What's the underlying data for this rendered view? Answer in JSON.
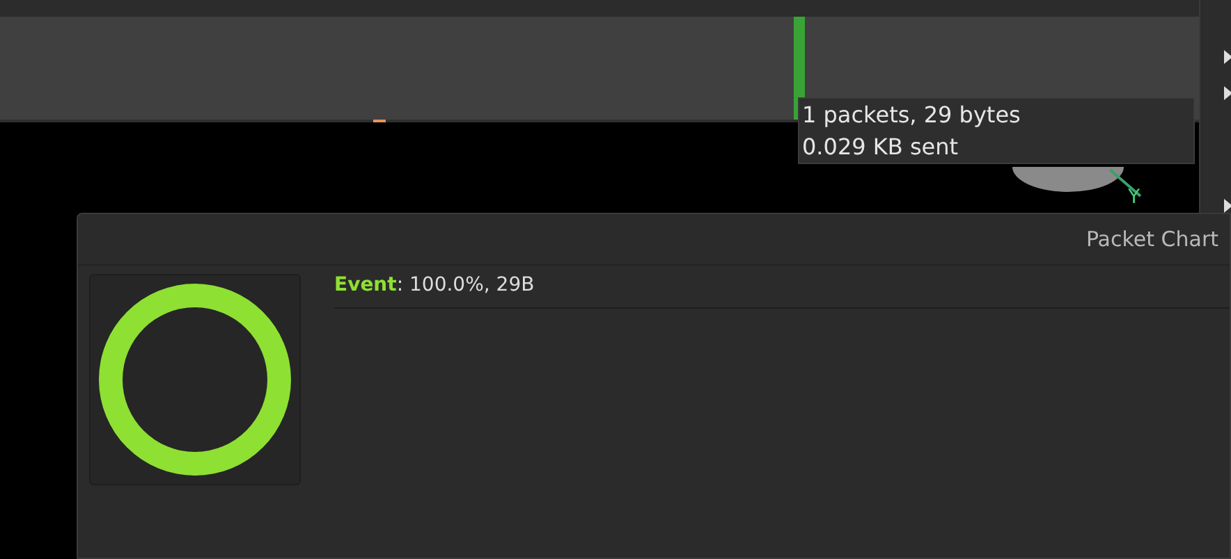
{
  "timeline": {
    "tooltip": {
      "lines": [
        "1 packets, 29 bytes",
        "0.029 KB sent"
      ]
    }
  },
  "viewport": {
    "axis_label": "Y"
  },
  "packet_chart": {
    "title": "Packet Chart",
    "legend": [
      {
        "name": "Event",
        "color": "#8ee033",
        "detail": ": 100.0%, 29B"
      }
    ]
  }
}
